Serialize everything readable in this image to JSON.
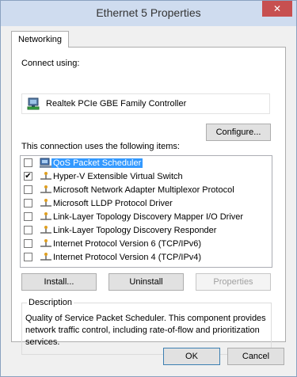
{
  "window": {
    "title": "Ethernet 5 Properties",
    "close_glyph": "✕"
  },
  "tab": {
    "label": "Networking"
  },
  "connect_using": {
    "label": "Connect using:",
    "adapter_name": "Realtek PCIe GBE Family Controller",
    "adapter_icon": "network-adapter-icon"
  },
  "buttons": {
    "configure": "Configure...",
    "install": "Install...",
    "uninstall": "Uninstall",
    "properties": "Properties",
    "ok": "OK",
    "cancel": "Cancel"
  },
  "items_label": "This connection uses the following items:",
  "items": [
    {
      "label": "QoS Packet Scheduler",
      "checked": false,
      "selected": true,
      "icon": "qos-scheduler-icon"
    },
    {
      "label": "Hyper-V Extensible Virtual Switch",
      "checked": true,
      "selected": false,
      "icon": "protocol-icon"
    },
    {
      "label": "Microsoft Network Adapter Multiplexor Protocol",
      "checked": false,
      "selected": false,
      "icon": "protocol-icon"
    },
    {
      "label": "Microsoft LLDP Protocol Driver",
      "checked": false,
      "selected": false,
      "icon": "protocol-icon"
    },
    {
      "label": "Link-Layer Topology Discovery Mapper I/O Driver",
      "checked": false,
      "selected": false,
      "icon": "protocol-icon"
    },
    {
      "label": "Link-Layer Topology Discovery Responder",
      "checked": false,
      "selected": false,
      "icon": "protocol-icon"
    },
    {
      "label": "Internet Protocol Version 6 (TCP/IPv6)",
      "checked": false,
      "selected": false,
      "icon": "protocol-icon"
    },
    {
      "label": "Internet Protocol Version 4 (TCP/IPv4)",
      "checked": false,
      "selected": false,
      "icon": "protocol-icon"
    }
  ],
  "description": {
    "legend": "Description",
    "text": "Quality of Service Packet Scheduler.  This component provides network traffic control, including rate-of-flow and prioritization services."
  },
  "colors": {
    "selection": "#3399ff",
    "close_button": "#c75050",
    "titlebar": "#cfdcef"
  }
}
